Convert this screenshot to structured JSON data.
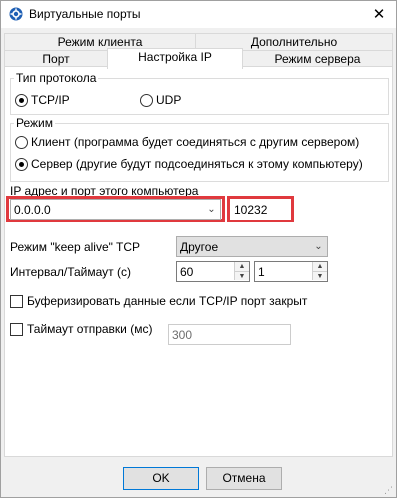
{
  "window": {
    "title": "Виртуальные порты",
    "close_glyph": "✕",
    "icon": "app-gear-icon"
  },
  "tabs": {
    "row_back": [
      "Режим клиента",
      "Дополнительно"
    ],
    "row_front": [
      "Порт",
      "Настройка IP",
      "Режим сервера"
    ],
    "selected": "Настройка IP"
  },
  "protocol": {
    "label": "Тип протокола",
    "options": [
      "TCP/IP",
      "UDP"
    ],
    "selected": "TCP/IP"
  },
  "mode": {
    "label": "Режим",
    "options": [
      "Клиент (программа будет соединяться с другим сервером)",
      "Сервер (другие будут подсоединяться к этому компьютеру)"
    ],
    "selected": "Сервер (другие будут подсоединяться к этому компьютеру)"
  },
  "ip": {
    "label": "IP адрес и порт этого компьютера",
    "address": "0.0.0.0",
    "port": "10232",
    "highlight_color": "#e0393e"
  },
  "keepalive": {
    "label": "Режим \"keep alive\" TCP",
    "value": "Другое"
  },
  "interval": {
    "label": "Интервал/Таймаут (с)",
    "value1": "60",
    "value2": "1"
  },
  "buffer": {
    "label": "Буферизировать данные если TCP/IP порт закрыт",
    "checked": false
  },
  "send_timeout": {
    "label": "Таймаут отправки (мс)",
    "checked": false,
    "value": "300"
  },
  "buttons": {
    "ok": "OK",
    "cancel": "Отмена"
  }
}
